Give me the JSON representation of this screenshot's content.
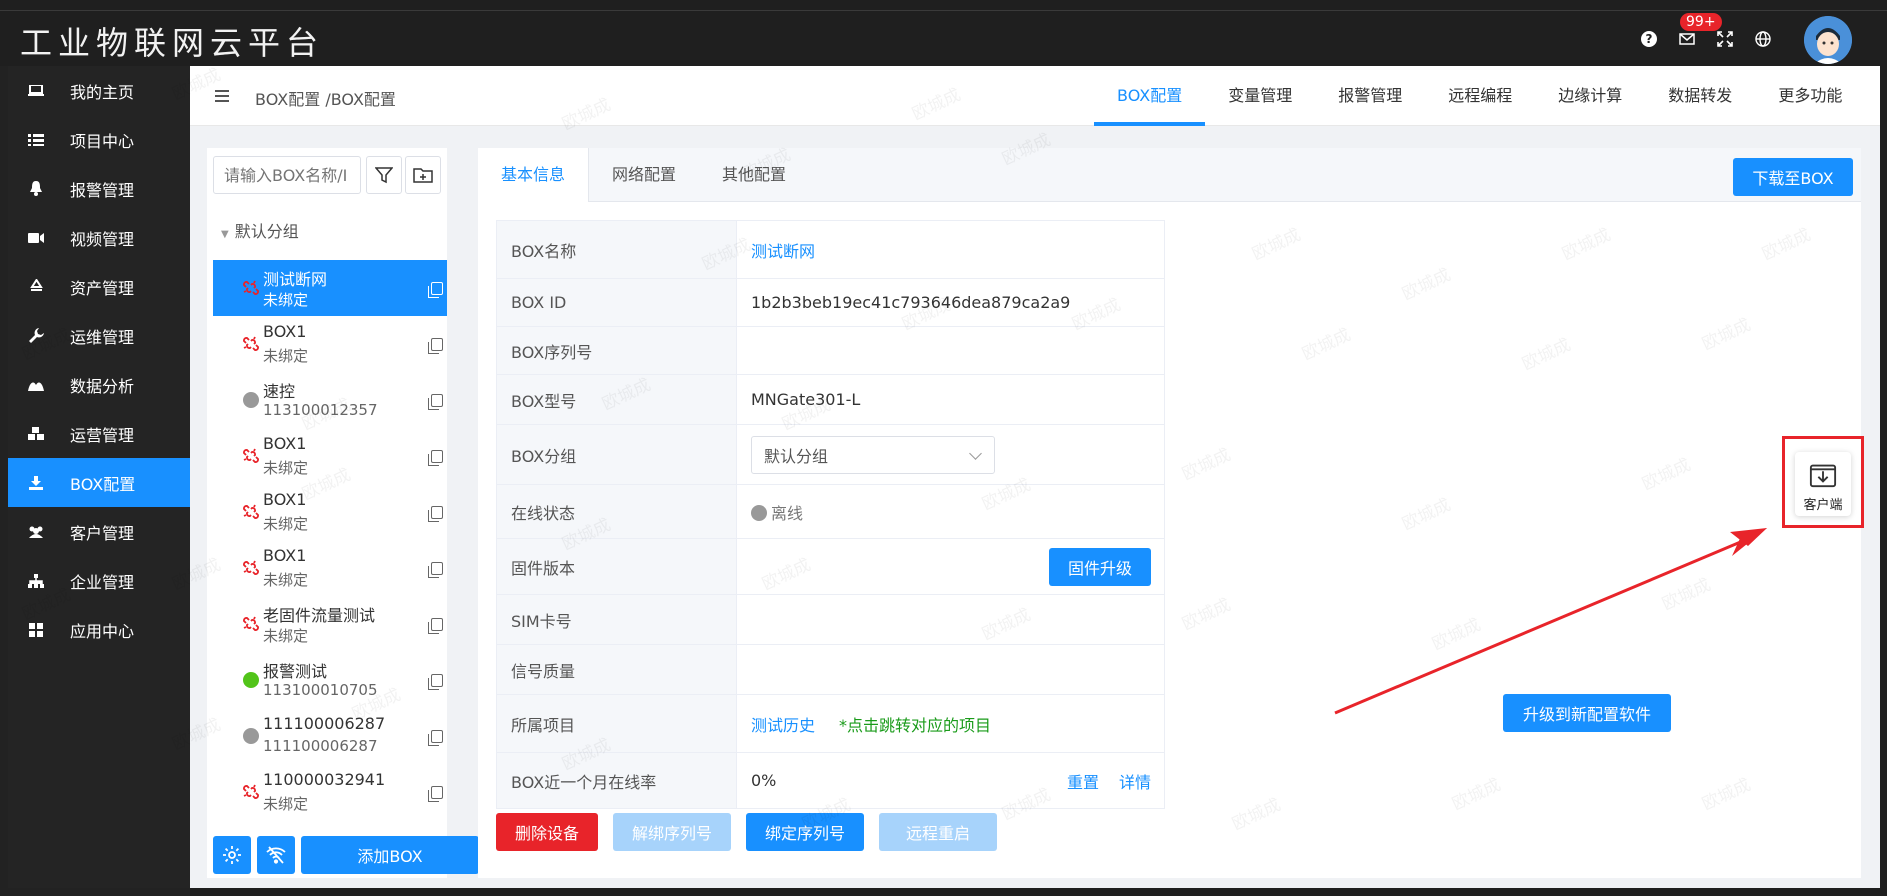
{
  "app": {
    "title": "工业物联网云平台"
  },
  "header": {
    "badge": "99+",
    "icons": [
      "help-icon",
      "mail-icon",
      "fullscreen-icon",
      "globe-icon",
      "avatar"
    ]
  },
  "sidebar": {
    "items": [
      {
        "label": "我的主页",
        "icon": "laptop-icon"
      },
      {
        "label": "项目中心",
        "icon": "list-icon"
      },
      {
        "label": "报警管理",
        "icon": "bell-icon"
      },
      {
        "label": "视频管理",
        "icon": "video-icon"
      },
      {
        "label": "资产管理",
        "icon": "recycle-icon"
      },
      {
        "label": "运维管理",
        "icon": "wrench-icon"
      },
      {
        "label": "数据分析",
        "icon": "chart-icon"
      },
      {
        "label": "运营管理",
        "icon": "cubes-icon"
      },
      {
        "label": "BOX配置",
        "icon": "download-icon",
        "active": true
      },
      {
        "label": "客户管理",
        "icon": "users-icon"
      },
      {
        "label": "企业管理",
        "icon": "sitemap-icon"
      },
      {
        "label": "应用中心",
        "icon": "grid-icon"
      }
    ]
  },
  "breadcrumb": "BOX配置 /BOX配置",
  "top_tabs": [
    "BOX配置",
    "变量管理",
    "报警管理",
    "远程编程",
    "边缘计算",
    "数据转发",
    "更多功能"
  ],
  "device_list": {
    "search_placeholder": "请输入BOX名称/I",
    "group": "默认分组",
    "items": [
      {
        "name": "测试断网",
        "sub": "未绑定",
        "status": "unlinked",
        "active": true
      },
      {
        "name": "BOX1",
        "sub": "未绑定",
        "status": "unlinked"
      },
      {
        "name": "速控",
        "sub": "113100012357",
        "status": "offline"
      },
      {
        "name": "BOX1",
        "sub": "未绑定",
        "status": "unlinked"
      },
      {
        "name": "BOX1",
        "sub": "未绑定",
        "status": "unlinked"
      },
      {
        "name": "BOX1",
        "sub": "未绑定",
        "status": "unlinked"
      },
      {
        "name": "老固件流量测试",
        "sub": "未绑定",
        "status": "unlinked"
      },
      {
        "name": "报警测试",
        "sub": "113100010705",
        "status": "online"
      },
      {
        "name": "111100006287",
        "sub": "111100006287",
        "status": "offline"
      },
      {
        "name": "110000032941",
        "sub": "未绑定",
        "status": "unlinked"
      }
    ],
    "add_button": "添加BOX"
  },
  "detail": {
    "tabs": [
      "基本信息",
      "网络配置",
      "其他配置"
    ],
    "download_button": "下载至BOX",
    "rows": {
      "name_label": "BOX名称",
      "name_value": "测试断网",
      "id_label": "BOX ID",
      "id_value": "1b2b3beb19ec41c793646dea879ca2a9",
      "serial_label": "BOX序列号",
      "serial_value": "",
      "model_label": "BOX型号",
      "model_value": "MNGate301-L",
      "group_label": "BOX分组",
      "group_value": "默认分组",
      "online_label": "在线状态",
      "online_value": "离线",
      "firmware_label": "固件版本",
      "firmware_button": "固件升级",
      "sim_label": "SIM卡号",
      "signal_label": "信号质量",
      "project_label": "所属项目",
      "project_value": "测试历史",
      "project_note": "*点击跳转对应的项目",
      "rate_label": "BOX近一个月在线率",
      "rate_value": "0%",
      "reset_link": "重置",
      "detail_link": "详情"
    },
    "actions": {
      "delete": "删除设备",
      "unbind": "解绑序列号",
      "bind": "绑定序列号",
      "reboot": "远程重启"
    },
    "upgrade_button": "升级到新配置软件"
  },
  "client_float": {
    "label": "客户端"
  },
  "watermark": "欧城成",
  "colors": {
    "primary": "#1890ff",
    "danger": "#e8242a",
    "dark": "#1f1f1f",
    "online": "#52c41a",
    "offline": "#999999"
  }
}
